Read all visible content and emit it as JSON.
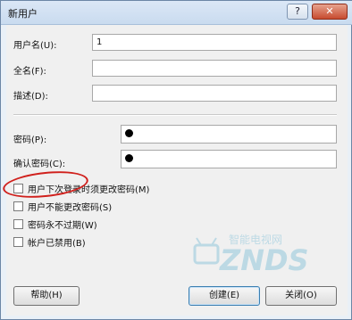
{
  "window": {
    "title": "新用户",
    "help_glyph": "?",
    "close_glyph": "✕"
  },
  "form": {
    "username_label": "用户名(U):",
    "username_value": "1",
    "fullname_label": "全名(F):",
    "fullname_value": "",
    "description_label": "描述(D):",
    "description_value": "",
    "password_label": "密码(P):",
    "confirm_label": "确认密码(C):"
  },
  "options": [
    {
      "label": "用户下次登录时须更改密码(M)",
      "checked": false
    },
    {
      "label": "用户不能更改密码(S)",
      "checked": false
    },
    {
      "label": "密码永不过期(W)",
      "checked": false
    },
    {
      "label": "帐户已禁用(B)",
      "checked": false
    }
  ],
  "buttons": {
    "help": "帮助(H)",
    "create": "创建(E)",
    "close": "关闭(O)"
  },
  "watermark": {
    "text": "ZNDS",
    "subtext": "智能电视网"
  },
  "colors": {
    "annotation": "#d0201c",
    "title_gradient_top": "#dbe7f6",
    "close_button": "#c74b2f"
  }
}
